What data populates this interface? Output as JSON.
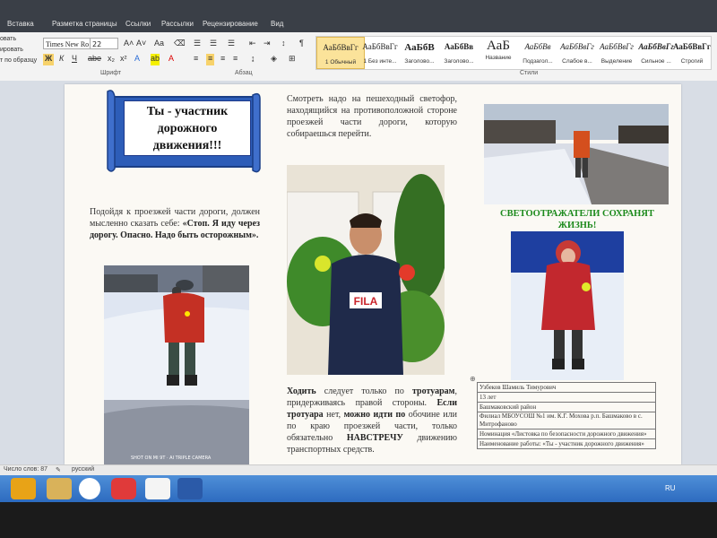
{
  "ribbon": {
    "tabs": [
      "Вставка",
      "Разметка страницы",
      "Ссылки",
      "Рассылки",
      "Рецензирование",
      "Вид"
    ],
    "clipboard": [
      "овать",
      "ировать",
      "т по образцу"
    ],
    "font_name": "Times New Ro",
    "font_size": "22",
    "group_font": "Шрифт",
    "group_paragraph": "Абзац",
    "group_styles": "Стили",
    "styles": [
      {
        "sample": "АаБбВвГг",
        "name": "1 Обычный"
      },
      {
        "sample": "АаБбВвГг",
        "name": "1 Без инте..."
      },
      {
        "sample": "АаБбВ",
        "name": "Заголово..."
      },
      {
        "sample": "АаБбВв",
        "name": "Заголово..."
      },
      {
        "sample": "АаБ",
        "name": "Название"
      },
      {
        "sample": "АаБбВв",
        "name": "Подзагол..."
      },
      {
        "sample": "АаБбВвГг",
        "name": "Слабое в..."
      },
      {
        "sample": "АаБбВвГг",
        "name": "Выделение"
      },
      {
        "sample": "АаБбВвГг",
        "name": "Сильное ..."
      },
      {
        "sample": "АаБбВвГг",
        "name": "Строгий"
      }
    ]
  },
  "document": {
    "banner_title": "Ты - участник дорожного движения!!!",
    "left_para_1": "Подойдя к проезжей части дороги, должен мысленно сказать себе: ",
    "left_para_bold": "«Стоп. Я иду через дорогу. Опасно. Надо быть осторожным».",
    "middle_para": "Смотреть надо на пешеходный светофор, находящийся на противоположной стороне проезжей части дороги, которую собираешься перейти.",
    "green_heading": "СВЕТООТРАЖАТЕЛИ СОХРАНЯТ ЖИЗНЬ!",
    "bottom_para": {
      "w1": "Ходить",
      "t1": " следует только по ",
      "w2": "тротуарам",
      "t2": ", придерживаясь правой стороны. ",
      "w3": "Если тротуара",
      "t3": " нет, ",
      "w4": "можно идти по",
      "t4": " обочине или по краю проезжей части, только обязательно ",
      "w5": "НАВСТРЕЧУ",
      "t5": " движению транспортных средств."
    },
    "photo_caption": "SHOT ON MI 9T · AI TRIPLE CAMERA",
    "fila_logo": "FILA",
    "info": [
      "Узбеков Шамиль Тимурович",
      "13 лет",
      "Башмаковский район",
      "Филиал МБОУСОШ №1 им. К.Г. Мохова р.п. Башмаково в с. Митрофаново",
      "Номинация «Листовка по безопасности дорожного движения»",
      "Наименование работы: «Ты - участник дорожного движения»"
    ]
  },
  "statusbar": {
    "words": "Число слов: 87",
    "language": "русский"
  },
  "taskbar": {
    "lang": "RU"
  }
}
